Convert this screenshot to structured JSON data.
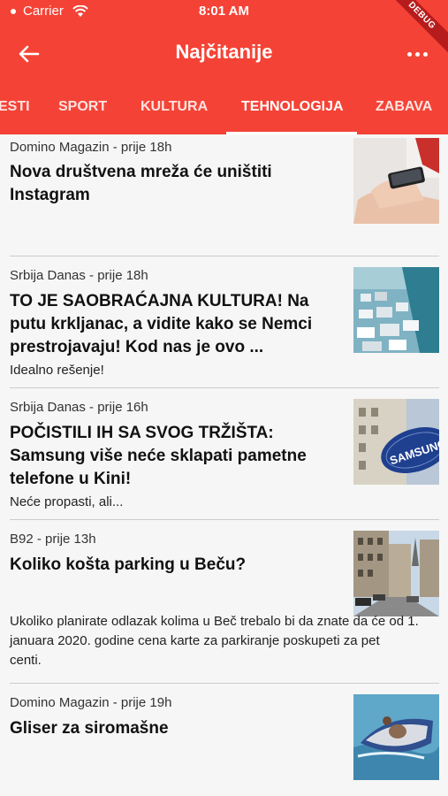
{
  "status_bar": {
    "carrier": "Carrier",
    "time": "8:01 AM",
    "debug_label": "DEBUG"
  },
  "appbar": {
    "title": "Najčitanije"
  },
  "tabs": [
    {
      "label": "ESTI"
    },
    {
      "label": "SPORT"
    },
    {
      "label": "KULTURA"
    },
    {
      "label": "TEHNOLOGIJA",
      "active": true
    },
    {
      "label": "ZABAVA"
    }
  ],
  "articles": [
    {
      "source": "Domino Magazin - prije 18h",
      "headline_lines": [
        "Nova društvena mreža će uništiti",
        "Instagram"
      ],
      "summary": "",
      "image": "phone-hands-image"
    },
    {
      "source": "Srbija Danas - prije 18h",
      "headline_lines": [
        "TO JE SAOBRAĆAJNA KULTURA! Na",
        "putu krkljanac, a vidite kako se Nemci",
        "prestrojavaju! Kod nas je ovo ..."
      ],
      "summary": "Idealno rešenje!",
      "image": "traffic-image"
    },
    {
      "source": "Srbija Danas - prije 16h",
      "headline_lines": [
        "POČISTILI IH SA SVOG TRŽIŠTA:",
        "Samsung više neće sklapati pametne",
        "telefone u Kini!"
      ],
      "summary": "Neće propasti, ali...",
      "image": "samsung-sign-image"
    },
    {
      "source": "B92 - prije 13h",
      "headline_lines": [
        "Koliko košta parking u Beču?"
      ],
      "summary_lines": [
        "Ukoliko planirate odlazak kolima u Beč trebalo bi da znate da će od 1.",
        "januara 2020. godine cena karte za parkiranje poskupeti za pet",
        "centi."
      ],
      "image": "vienna-street-image"
    },
    {
      "source": "Domino Magazin - prije 19h",
      "headline_lines": [
        "Gliser za siromašne"
      ],
      "summary": "",
      "image": "jetboat-image"
    }
  ],
  "colors": {
    "accent": "#f44336",
    "background": "#f6f6f6"
  }
}
